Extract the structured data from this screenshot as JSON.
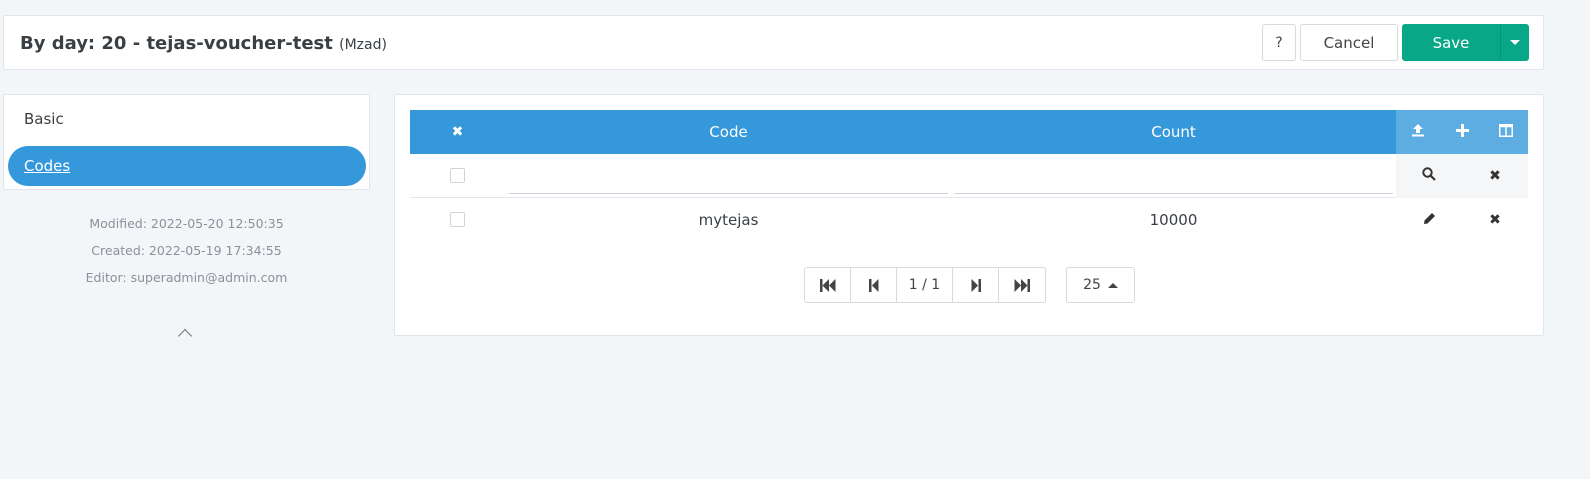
{
  "header": {
    "title": "By day: 20 - tejas-voucher-test",
    "subtitle": "(Mzad)",
    "help_label": "?",
    "cancel_label": "Cancel",
    "save_label": "Save"
  },
  "nav": {
    "items": [
      {
        "label": "Basic",
        "active": false
      },
      {
        "label": "Codes",
        "active": true
      }
    ]
  },
  "meta": {
    "modified": "Modified: 2022-05-20 12:50:35",
    "created": "Created: 2022-05-19 17:34:55",
    "editor": "Editor: superadmin@admin.com"
  },
  "grid": {
    "columns": [
      {
        "label": "Code"
      },
      {
        "label": "Count"
      }
    ],
    "header_icons": [
      "clear-icon",
      "upload-icon",
      "add-icon",
      "columns-icon"
    ],
    "filter": {
      "code_value": "",
      "count_value": ""
    },
    "rows": [
      {
        "code": "mytejas",
        "count": "10000"
      }
    ]
  },
  "pagination": {
    "page_info": "1 / 1",
    "page_size": "25"
  },
  "colors": {
    "accent": "#3498db",
    "accent_light": "#5dade2",
    "save": "#08a788"
  }
}
